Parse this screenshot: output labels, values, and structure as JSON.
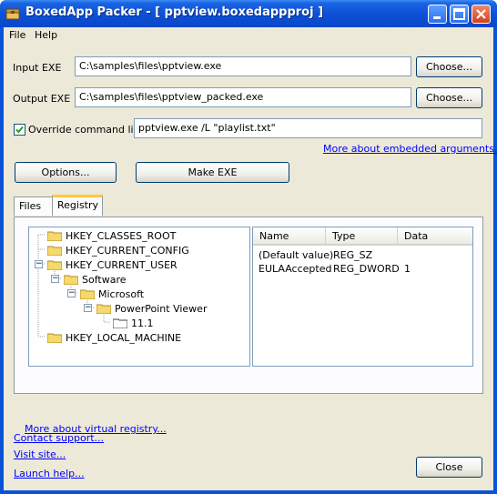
{
  "window": {
    "title": "BoxedApp Packer - [ pptview.boxedappproj ]"
  },
  "menu": {
    "file": "File",
    "help": "Help"
  },
  "input_exe": {
    "label": "Input EXE",
    "value": "C:\\samples\\files\\pptview.exe",
    "choose": "Choose..."
  },
  "output_exe": {
    "label": "Output EXE",
    "value": "C:\\samples\\files\\pptview_packed.exe",
    "choose": "Choose..."
  },
  "override": {
    "label": "Override command line",
    "checked": true,
    "value": "pptview.exe /L \"playlist.txt\""
  },
  "links": {
    "embedded_args": "More about embedded arguments...",
    "virtual_registry": "More about virtual registry...",
    "contact_support": "Contact support...",
    "visit_site": "Visit site...",
    "launch_help": "Launch help..."
  },
  "buttons": {
    "options": "Options...",
    "make_exe": "Make EXE",
    "close": "Close"
  },
  "tabs": [
    {
      "label": "Files"
    },
    {
      "label": "Registry",
      "active": true
    }
  ],
  "tree": [
    {
      "label": "HKEY_CLASSES_ROOT"
    },
    {
      "label": "HKEY_CURRENT_CONFIG"
    },
    {
      "label": "HKEY_CURRENT_USER"
    },
    {
      "label": "Software"
    },
    {
      "label": "Microsoft"
    },
    {
      "label": "PowerPoint Viewer"
    },
    {
      "label": "11.1"
    },
    {
      "label": "HKEY_LOCAL_MACHINE"
    }
  ],
  "values_list": {
    "columns": [
      "Name",
      "Type",
      "Data"
    ],
    "rows": [
      [
        "(Default value)",
        "REG_SZ",
        ""
      ],
      [
        "EULAAccepted",
        "REG_DWORD",
        "1"
      ]
    ]
  },
  "colors": {
    "titlebar": "#0a53d8",
    "dialog": "#ece9d8",
    "link": "#0000ff",
    "folder": "#f5d96b"
  }
}
